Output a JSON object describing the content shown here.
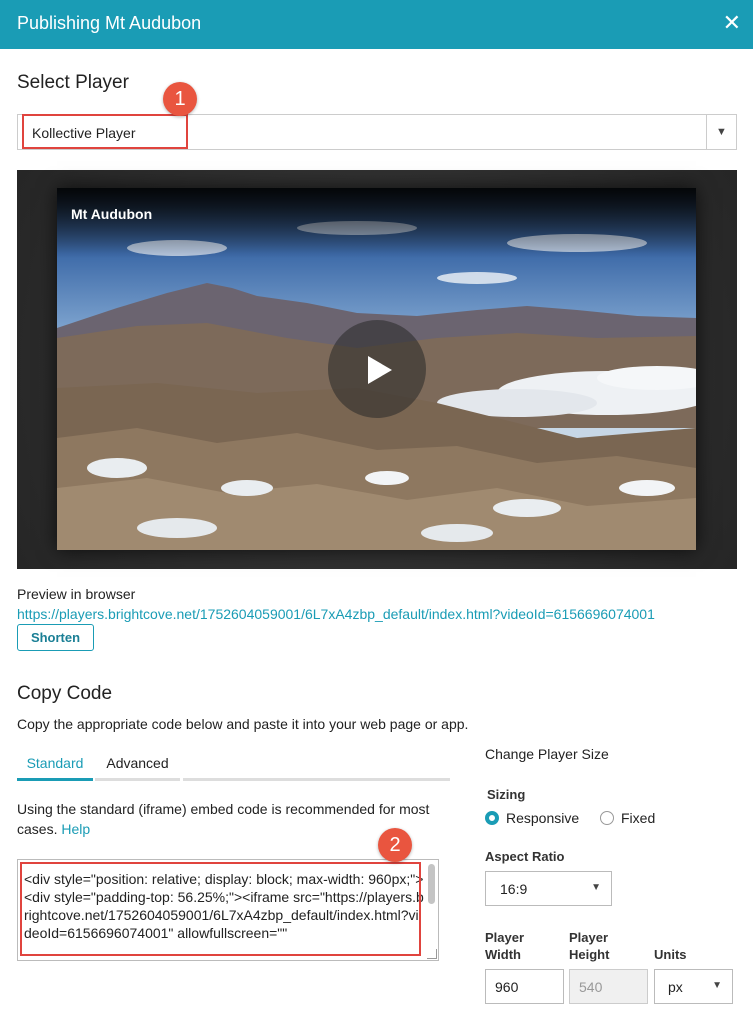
{
  "header": {
    "title": "Publishing Mt Audubon",
    "close_glyph": "✕"
  },
  "select_player": {
    "heading": "Select Player",
    "selected": "Kollective Player",
    "arrow": "▼"
  },
  "callouts": {
    "one": "1",
    "two": "2"
  },
  "video": {
    "title": "Mt Audubon"
  },
  "preview": {
    "label": "Preview in browser",
    "url": "https://players.brightcove.net/1752604059001/6L7xA4zbp_default/index.html?videoId=6156696074001",
    "shorten_label": "Shorten"
  },
  "copy_code": {
    "heading": "Copy Code",
    "description": "Copy the appropriate code below and paste it into your web page or app.",
    "tabs": [
      "Standard",
      "Advanced"
    ],
    "standard_desc": "Using the standard (iframe) embed code is recommended for most cases.",
    "help_label": "Help",
    "code": "<div style=\"position: relative; display: block; max-width: 960px;\"><div style=\"padding-top: 56.25%;\"><iframe src=\"https://players.brightcove.net/1752604059001/6L7xA4zbp_default/index.html?videoId=6156696074001\" allowfullscreen=\"\""
  },
  "player_size": {
    "heading": "Change Player Size",
    "sizing_label": "Sizing",
    "sizing_options": [
      "Responsive",
      "Fixed"
    ],
    "sizing_selected": "Responsive",
    "aspect_label": "Aspect Ratio",
    "aspect_value": "16:9",
    "width_label": "Player Width",
    "height_label": "Player Height",
    "units_label": "Units",
    "width_value": "960",
    "height_value": "540",
    "units_value": "px"
  },
  "colors": {
    "accent": "#1a9cb5",
    "callout": "#e0443e"
  }
}
